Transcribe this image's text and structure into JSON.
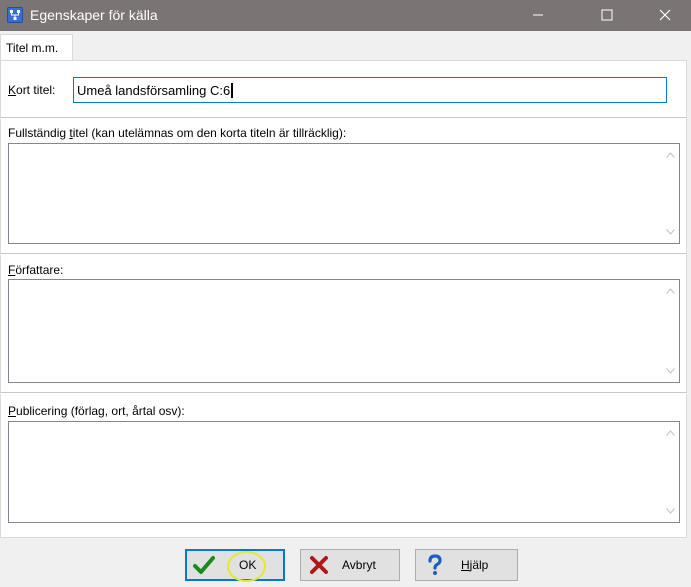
{
  "window": {
    "title": "Egenskaper för källa",
    "app_icon": "family-tree-icon",
    "controls": [
      "minimize-icon",
      "maximize-icon",
      "close-icon"
    ]
  },
  "tabs": [
    {
      "label": "Titel m.m.",
      "active": true
    }
  ],
  "form": {
    "short_title": {
      "label": "Kort titel:",
      "value": "Umeå landsförsamling C:6"
    },
    "full_title": {
      "label": "Fullständig titel (kan utelämnas om den korta titeln är tillräcklig):",
      "value": ""
    },
    "author": {
      "label": "Författare:",
      "value": ""
    },
    "publishing": {
      "label": "Publicering (förlag, ort, årtal osv):",
      "value": ""
    }
  },
  "buttons": {
    "ok": {
      "label": "OK",
      "icon": "checkmark-icon"
    },
    "cancel": {
      "label": "Avbryt",
      "icon": "x-cross-icon"
    },
    "help": {
      "label": "Hjälp",
      "icon": "question-mark-icon"
    }
  },
  "colors": {
    "titlebar": "#7a7574",
    "focus_border": "#0078d7",
    "ok_check": "#1a8a1a",
    "cancel_x": "#b01818",
    "help_q": "#1a5fc8",
    "highlight_ring": "#e6e633"
  }
}
